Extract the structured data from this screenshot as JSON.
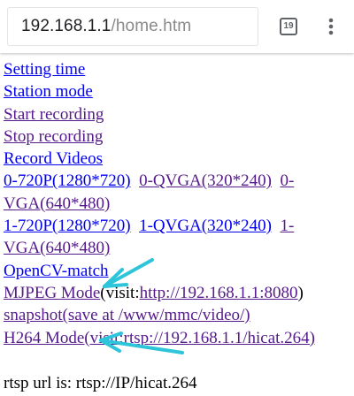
{
  "browser": {
    "url_host": "192.168.1.1",
    "url_path": "/home.htm",
    "tab_count": "19",
    "menu_icon": "more-vert-icon",
    "tabs_icon": "tab-switcher-icon"
  },
  "links": {
    "setting_time": "Setting time",
    "station_mode": "Station mode",
    "start_recording": "Start recording",
    "stop_recording": "Stop recording",
    "record_videos": "Record Videos",
    "res_0_720p": "0-720P(1280*720)",
    "res_0_qvga": "0-QVGA(320*240)",
    "res_0_vga": "0-VGA(640*480)",
    "res_1_720p": "1-720P(1280*720)",
    "res_1_qvga": "1-QVGA(320*240)",
    "res_1_vga": "1-VGA(640*480)",
    "opencv_match": "OpenCV-match",
    "mjpeg_mode": "MJPEG Mode",
    "mjpeg_visit_prefix": "(visit:",
    "mjpeg_url": "http://192.168.1.1:8080",
    "mjpeg_visit_suffix": ")",
    "snapshot": "snapshot(save at /www/mmc/video/)",
    "h264_mode": "H264 Mode(visit:rtsp://192.168.1.1/hicat.264)"
  },
  "footer_text": "rtsp url is: rtsp://IP/hicat.264",
  "colors": {
    "link": "#0000ee",
    "visited": "#551a8b",
    "annotation_arrow": "#2ec4d9"
  }
}
